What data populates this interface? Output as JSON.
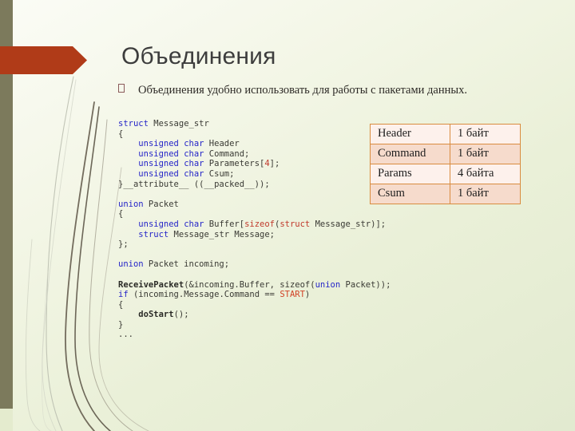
{
  "slide": {
    "title": "Объединения",
    "bullet": {
      "glyph": "box-bullet-icon",
      "text": "Объединения удобно использовать для работы с пакетами данных."
    }
  },
  "code": {
    "language": "c",
    "lines": [
      [
        {
          "t": "struct",
          "c": "kw"
        },
        {
          "t": " Message_str",
          "c": ""
        }
      ],
      [
        {
          "t": "{",
          "c": ""
        }
      ],
      [
        {
          "t": "    ",
          "c": ""
        },
        {
          "t": "unsigned char",
          "c": "kw"
        },
        {
          "t": " Header",
          "c": ""
        }
      ],
      [
        {
          "t": "    ",
          "c": ""
        },
        {
          "t": "unsigned char",
          "c": "kw"
        },
        {
          "t": " Command;",
          "c": ""
        }
      ],
      [
        {
          "t": "    ",
          "c": ""
        },
        {
          "t": "unsigned char",
          "c": "kw"
        },
        {
          "t": " Parameters[",
          "c": ""
        },
        {
          "t": "4",
          "c": "num"
        },
        {
          "t": "];",
          "c": ""
        }
      ],
      [
        {
          "t": "    ",
          "c": ""
        },
        {
          "t": "unsigned char",
          "c": "kw"
        },
        {
          "t": " Csum;",
          "c": ""
        }
      ],
      [
        {
          "t": "}__attribute__ ((__packed__));",
          "c": ""
        }
      ],
      [
        {
          "t": "",
          "c": ""
        }
      ],
      [
        {
          "t": "union",
          "c": "kw"
        },
        {
          "t": " Packet",
          "c": ""
        }
      ],
      [
        {
          "t": "{",
          "c": ""
        }
      ],
      [
        {
          "t": "    ",
          "c": ""
        },
        {
          "t": "unsigned char",
          "c": "kw"
        },
        {
          "t": " Buffer[",
          "c": ""
        },
        {
          "t": "sizeof",
          "c": "kw-red"
        },
        {
          "t": "(",
          "c": ""
        },
        {
          "t": "struct",
          "c": "kw-red"
        },
        {
          "t": " Message_str)];",
          "c": ""
        }
      ],
      [
        {
          "t": "    ",
          "c": ""
        },
        {
          "t": "struct",
          "c": "kw"
        },
        {
          "t": " Message_str Message;",
          "c": ""
        }
      ],
      [
        {
          "t": "};",
          "c": ""
        }
      ],
      [
        {
          "t": "",
          "c": ""
        }
      ],
      [
        {
          "t": "union",
          "c": "kw"
        },
        {
          "t": " Packet incoming;",
          "c": ""
        }
      ],
      [
        {
          "t": "",
          "c": ""
        }
      ],
      [
        {
          "t": "ReceivePacket",
          "c": "fn"
        },
        {
          "t": "(&incoming.Buffer, sizeof(",
          "c": ""
        },
        {
          "t": "union",
          "c": "kw"
        },
        {
          "t": " Packet));",
          "c": ""
        }
      ],
      [
        {
          "t": "if",
          "c": "kw"
        },
        {
          "t": " (incoming.Message.Command == ",
          "c": ""
        },
        {
          "t": "START",
          "c": "const"
        },
        {
          "t": ")",
          "c": ""
        }
      ],
      [
        {
          "t": "{",
          "c": ""
        }
      ],
      [
        {
          "t": "    ",
          "c": ""
        },
        {
          "t": "doStart",
          "c": "fn"
        },
        {
          "t": "();",
          "c": ""
        }
      ],
      [
        {
          "t": "}",
          "c": ""
        }
      ],
      [
        {
          "t": "...",
          "c": ""
        }
      ]
    ]
  },
  "packet_table": {
    "rows": [
      {
        "field": "Header",
        "size": "1 байт"
      },
      {
        "field": "Command",
        "size": "1 байт"
      },
      {
        "field": "Params",
        "size": "4 байта"
      },
      {
        "field": "Csum",
        "size": "1 байт"
      }
    ]
  },
  "decoration": {
    "band_color": "#7c7a5c",
    "arrow_color": "#b03b18",
    "table_border_color": "#d98c3f",
    "row_light_color": "#fdf1ec",
    "row_dark_color": "#f6dbcc",
    "title_color": "#3d3d3d",
    "background_top_color": "#fbfcf6",
    "background_bottom_color": "#e2ead0"
  }
}
